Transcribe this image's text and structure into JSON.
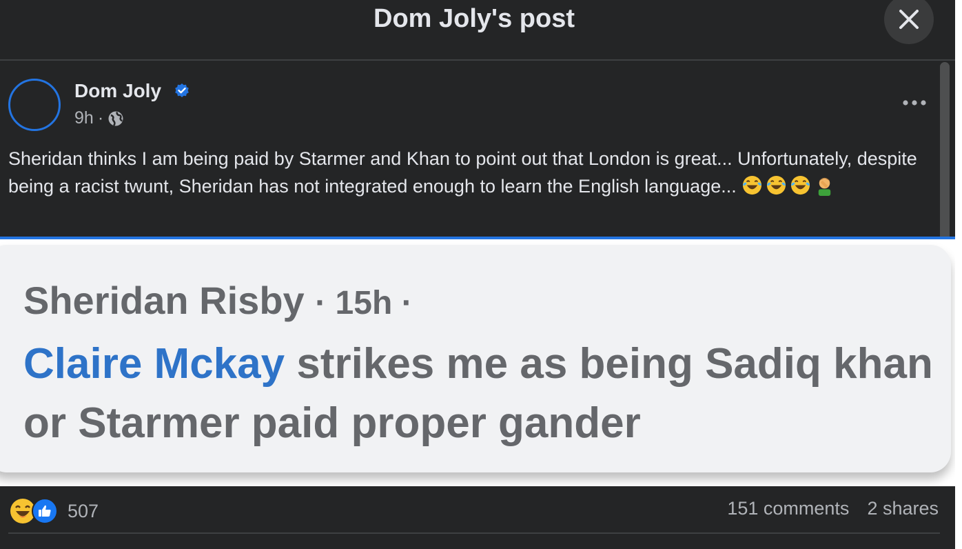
{
  "header": {
    "title": "Dom Joly's post"
  },
  "post": {
    "author": "Dom Joly",
    "time": "9h",
    "separator": "·",
    "text": "Sheridan thinks I am being paid by Starmer and Khan to point out that London is great... Unfortunately, despite being a racist twunt, Sheridan has not integrated enough to learn the English language...",
    "emojis": [
      "laughing-tears-emoji",
      "laughing-tears-emoji",
      "laughing-tears-emoji",
      "facepalm-emoji"
    ]
  },
  "image": {
    "commenter": "Sheridan Risby",
    "time": "· 15h ·",
    "mention": "Claire Mckay",
    "comment": "strikes me as being Sadiq khan or Starmer paid proper gander"
  },
  "footer": {
    "reaction_count": "507",
    "comments": "151 comments",
    "shares": "2 shares"
  },
  "colors": {
    "background": "#242526",
    "accent": "#2374e1",
    "like": "#1877f2",
    "mention": "#2e73c8",
    "muted": "#b0b3b8"
  }
}
